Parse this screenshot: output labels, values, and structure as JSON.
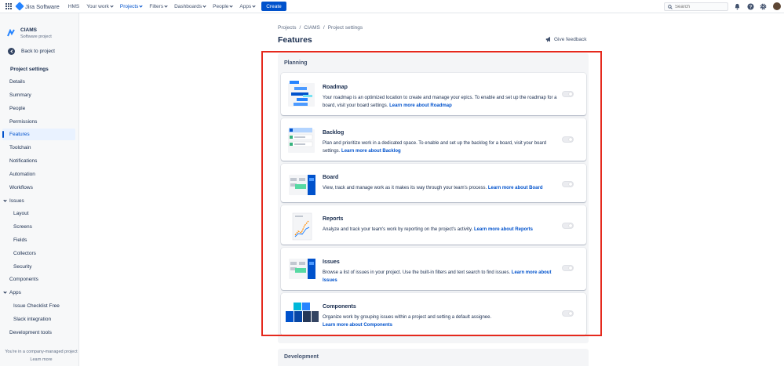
{
  "topnav": {
    "product": "Jira Software",
    "items": [
      "HMS",
      "Your work",
      "Projects",
      "Filters",
      "Dashboards",
      "People",
      "Apps"
    ],
    "create_label": "Create",
    "search_placeholder": "Search"
  },
  "sidebar": {
    "project_name": "CIAMS",
    "project_type": "Software project",
    "back_label": "Back to project",
    "settings_title": "Project settings",
    "items": [
      "Details",
      "Summary",
      "People",
      "Permissions",
      "Features",
      "Toolchain",
      "Notifications",
      "Automation",
      "Workflows"
    ],
    "issues_section": "Issues",
    "issues_items": [
      "Layout",
      "Screens",
      "Fields",
      "Collectors",
      "Security"
    ],
    "components": "Components",
    "apps_section": "Apps",
    "apps_items": [
      "Issue Checklist Free",
      "Slack integration"
    ],
    "dev_tools": "Development tools",
    "footer_note": "You're in a company-managed project",
    "footer_link": "Learn more"
  },
  "main": {
    "breadcrumb": [
      "Projects",
      "CIAMS",
      "Project settings"
    ],
    "title": "Features",
    "feedback_label": "Give feedback",
    "planning_title": "Planning",
    "development_title": "Development",
    "features": [
      {
        "name": "Roadmap",
        "desc": "Your roadmap is an optimized location to create and manage your epics. To enable and set up the roadmap for a board, visit your board settings.",
        "link": "Learn more about Roadmap"
      },
      {
        "name": "Backlog",
        "desc": "Plan and prioritize work in a dedicated space. To enable and set up the backlog for a board, visit your board settings.",
        "link": "Learn more about Backlog"
      },
      {
        "name": "Board",
        "desc": "View, track and manage work as it makes its way through your team's process.",
        "link": "Learn more about Board"
      },
      {
        "name": "Reports",
        "desc": "Analyze and track your team's work by reporting on the project's activity.",
        "link": "Learn more about Reports"
      },
      {
        "name": "Issues",
        "desc": "Browse a list of issues in your project. Use the built-in filters and text search to find issues.",
        "link": "Learn more about Issues"
      },
      {
        "name": "Components",
        "desc": "Organize work by grouping issues within a project and setting a default assignee.",
        "link": "Learn more about Components"
      }
    ]
  },
  "colors": {
    "accent": "#0052cc",
    "highlight": "#e5291d"
  }
}
